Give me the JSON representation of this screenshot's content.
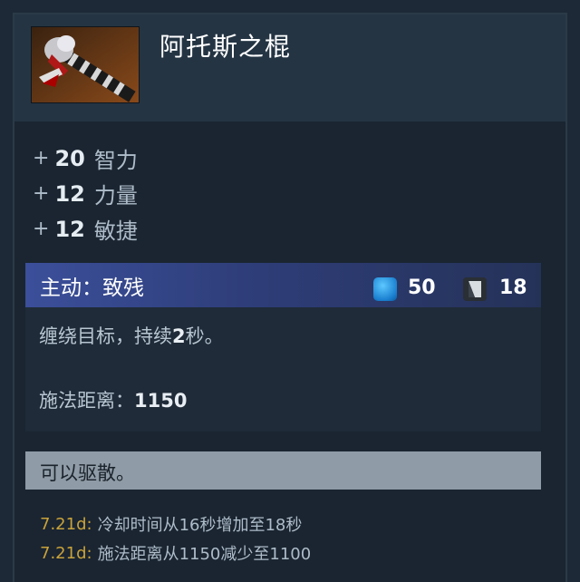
{
  "item": {
    "name": "阿托斯之棍",
    "icon": "rod-of-atos-icon"
  },
  "stats": [
    {
      "plus": "+",
      "value": "20",
      "label": "智力"
    },
    {
      "plus": "+",
      "value": "12",
      "label": "力量"
    },
    {
      "plus": "+",
      "value": "12",
      "label": "敏捷"
    }
  ],
  "ability": {
    "title": "主动：致残",
    "mana_icon": "mana-icon",
    "mana_cost": "50",
    "cooldown_icon": "cooldown-icon",
    "cooldown": "18",
    "description_pre": "缠绕目标，持续",
    "description_bold": "2",
    "description_post": "秒。",
    "range_label": "施法距离：",
    "range_value": "1150"
  },
  "dispel": "可以驱散。",
  "notes": [
    {
      "version": "7.21d:",
      "text": "冷却时间从16秒增加至18秒"
    },
    {
      "version": "7.21d:",
      "text": "施法距离从1150减少至1100"
    }
  ],
  "colors": {
    "background": "#1a2531",
    "active_bar": "#3b4f9a",
    "mana": "#1a7fd0",
    "version": "#c9a23a",
    "dispel_bar": "#8f9ba6"
  }
}
